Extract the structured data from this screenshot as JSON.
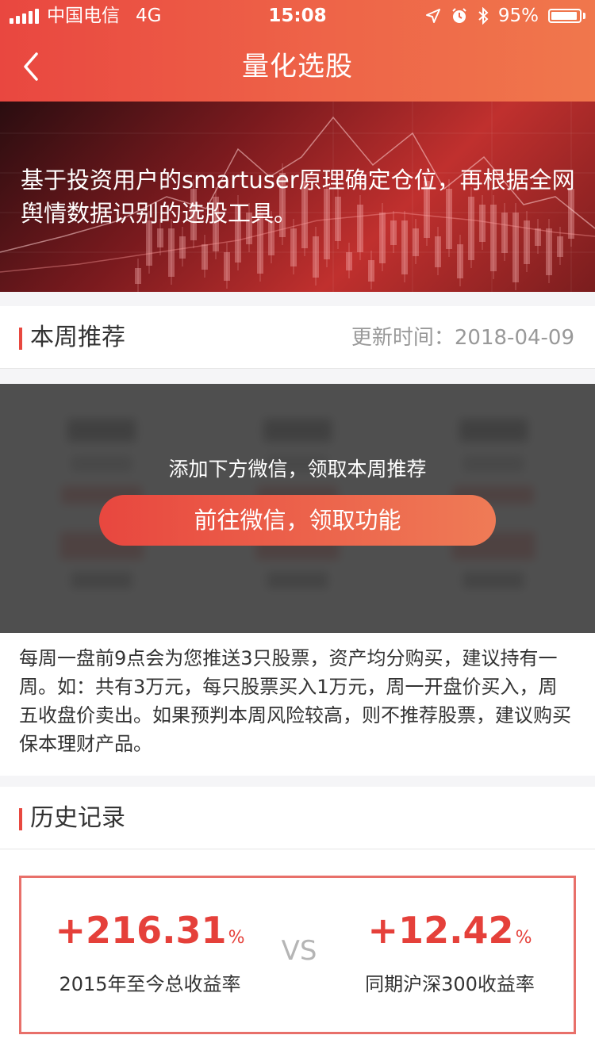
{
  "status_bar": {
    "carrier": "中国电信",
    "network": "4G",
    "time": "15:08",
    "battery": "95%",
    "battery_level": 0.95
  },
  "nav": {
    "title": "量化选股",
    "back_icon": "chevron-left-icon"
  },
  "banner": {
    "text": "基于投资用户的smartuser原理确定仓位，再根据全网舆情数据识别的选股工具。"
  },
  "weekly": {
    "title": "本周推荐",
    "update_label": "更新时间：",
    "update_date": "2018-04-09",
    "lock_tip": "添加下方微信，领取本周推荐",
    "lock_button": "前往微信，领取功能",
    "description": "每周一盘前9点会为您推送3只股票，资产均分购买，建议持有一周。如：共有3万元，每只股票买入1万元，周一开盘价买入，周五收盘价卖出。如果预判本周风险较高，则不推荐股票，建议购买保本理财产品。"
  },
  "history": {
    "title": "历史记录",
    "left_value": "+216.31",
    "left_unit": "%",
    "left_caption": "2015年至今总收益率",
    "vs": "VS",
    "right_value": "+12.42",
    "right_unit": "%",
    "right_caption": "同期沪深300收益率"
  },
  "colors": {
    "accent": "#e8483f",
    "nav_gradient_start": "#e94740",
    "nav_gradient_end": "#f0774c"
  }
}
